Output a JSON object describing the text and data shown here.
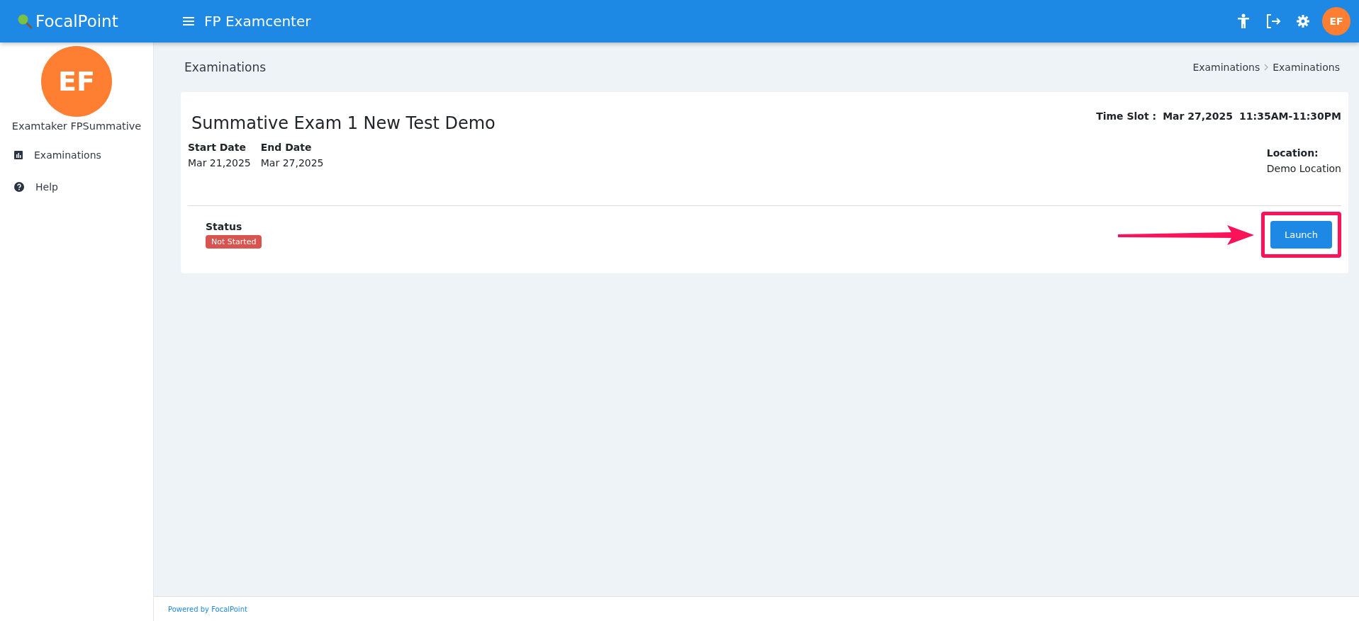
{
  "header": {
    "brand": "FocalPoint",
    "app_title": "FP Examcenter",
    "avatar_initials": "EF"
  },
  "sidebar": {
    "avatar_initials": "EF",
    "user_name": "Examtaker FPSummative",
    "items": [
      {
        "label": "Examinations",
        "kind": "chart"
      },
      {
        "label": "Help",
        "kind": "help"
      }
    ]
  },
  "page": {
    "title": "Examinations",
    "breadcrumb": [
      "Examinations",
      "Examinations"
    ]
  },
  "exam": {
    "title": "Summative Exam 1 New Test Demo",
    "time_slot_label": "Time Slot :",
    "time_slot_date": "Mar 27,2025",
    "time_slot_time": "11:35AM-11:30PM",
    "dates": [
      {
        "label": "Start Date",
        "value": "Mar 21,2025"
      },
      {
        "label": "End Date",
        "value": "Mar 27,2025"
      }
    ],
    "location_label": "Location:",
    "location_value": "Demo Location",
    "status_label": "Status",
    "status": {
      "label": "Not Started",
      "kind": "danger"
    },
    "launch_button": "Launch",
    "launch_highlighted": true
  },
  "footer": "Powered by FocalPoint"
}
